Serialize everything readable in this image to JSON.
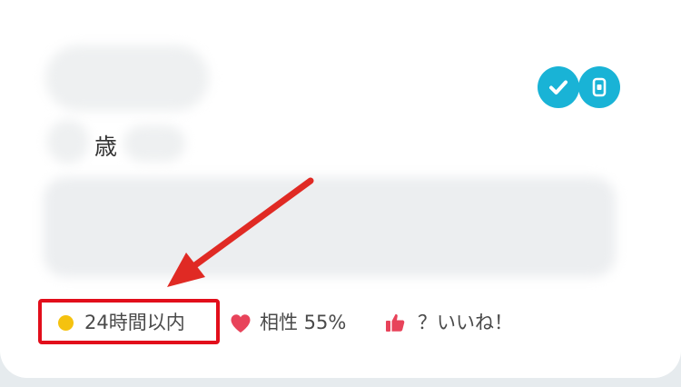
{
  "profile": {
    "age_suffix": "歳"
  },
  "badges": {
    "verified_icon": "check-icon",
    "id_icon": "id-card-icon",
    "color": "#19b3d6"
  },
  "status": {
    "online": {
      "label": "24時間以内",
      "dot_color": "#f5c20f",
      "icon": "online-dot-icon"
    },
    "match": {
      "label": "相性 55%",
      "icon": "heart-icon",
      "icon_color": "#e8435a"
    },
    "likes": {
      "label": "？いいね！",
      "icon": "thumbs-up-icon",
      "icon_color": "#e8435a"
    }
  },
  "annotation": {
    "highlight_color": "#e20e1b"
  }
}
